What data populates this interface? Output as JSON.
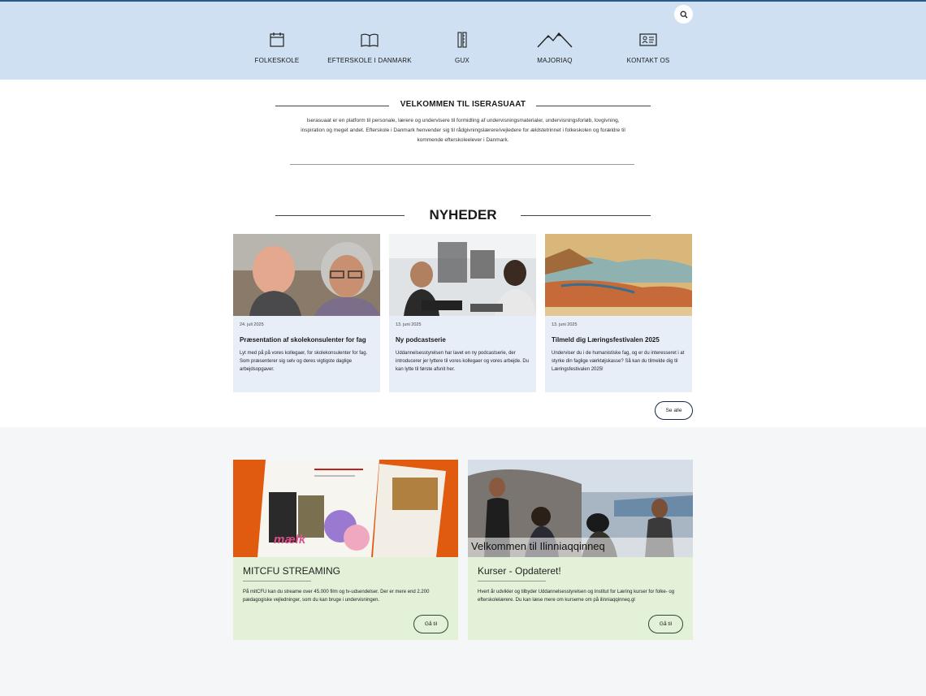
{
  "header": {
    "nav": [
      {
        "label": "FOLKESKOLE",
        "icon": "calendar-icon"
      },
      {
        "label": "EFTERSKOLE I DANMARK",
        "icon": "book-icon"
      },
      {
        "label": "GUX",
        "icon": "pencil-ruler-icon"
      },
      {
        "label": "MAJORIAQ",
        "icon": "mountain-icon"
      },
      {
        "label": "KONTAKT OS",
        "icon": "contact-card-icon"
      }
    ],
    "search_icon": "search-icon"
  },
  "welcome": {
    "title": "VELKOMMEN TIL ISERASUAAT",
    "text": "Iserasuaat er en platform til personale, lærere og undervisere til formidling af undervisningsmaterialer, undervisningsforløb, lovgivning, inspiration og meget andet. Efterskole i Danmark henvender sig til rådgivningslærere/vejledere for ældstetrinnet i folkeskolen og forældre til kommende efterskoleelever i Danmark."
  },
  "news": {
    "title": "NYHEDER",
    "items": [
      {
        "date": "24. juli 2025",
        "title": "Præsentation af skolekonsulenter for fag",
        "text": "Lyt med på på vores kollegaer, for skolekonsulenter for fag. Som præsenterer sig selv og deres vigtigste daglige arbejdsopgaver."
      },
      {
        "date": "13. juni 2025",
        "title": "Ny podcastserie",
        "text": "Uddannelsesstyrelsen har lavet en ny podcastserie, der introducerer jer lyttere til vores kollegaer og vores arbejde. Du kan lytte til første afsnit her."
      },
      {
        "date": "13. juni 2025",
        "title": "Tilmeld dig Læringsfestivalen 2025",
        "text": "Underviser du i de humanistiske fag, og er du interesseret i at styrke din faglige værktøjskasse? Så kan du tilmelde dig til Læringsfestivalen 2025!"
      }
    ],
    "see_all": "Se alle"
  },
  "promos": [
    {
      "title": "MITCFU STREAMING",
      "text": "På mitCFU kan du streame over 45.000 film og tv-udsendelser. Der er mere end 2.200 pædagogiske vejledninger, som du kan bruge i undervisningen.",
      "button": "Gå til",
      "image_text": "mælk"
    },
    {
      "title": "Kurser - Opdateret!",
      "overlay": "Velkommen til Ilinniaqqinneq",
      "text": "Hvert år udvikler og tilbyder Uddannelsesstyrelsen og Institut for Læring kurser for folke- og efterskolelærere. Du kan læse mere om kurserne om på ilinniaqqinneq.gl",
      "button": "Gå til"
    }
  ],
  "colors": {
    "header_bg": "#cfe0f2",
    "card_bg": "#e8eef8",
    "promo_bg": "#e2f1d8",
    "page_bg": "#f5f6f8"
  }
}
